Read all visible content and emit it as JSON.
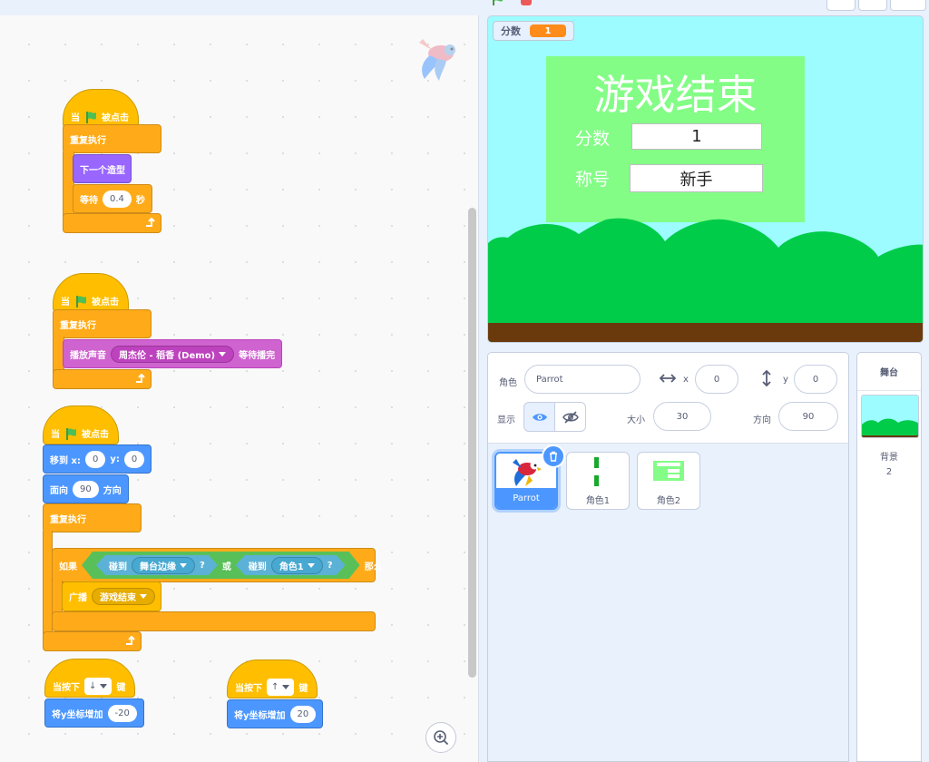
{
  "code": {
    "scripts": [
      {
        "hat": {
          "prefix": "当",
          "suffix": "被点击",
          "icon": "green-flag-icon"
        },
        "forever_label": "重复执行",
        "next_costume": "下一个造型",
        "wait_label": "等待",
        "wait_value": "0.4",
        "wait_unit": "秒"
      },
      {
        "hat": {
          "prefix": "当",
          "suffix": "被点击",
          "icon": "green-flag-icon"
        },
        "forever_label": "重复执行",
        "play_sound_label": "播放声音",
        "sound_name": "周杰伦 - 稻香 (Demo)",
        "play_sound_suffix": "等待播完"
      },
      {
        "hat": {
          "prefix": "当",
          "suffix": "被点击",
          "icon": "green-flag-icon"
        },
        "goto_label": "移到 x:",
        "goto_x": "0",
        "goto_y_label": "y:",
        "goto_y": "0",
        "point_label": "面向",
        "point_value": "90",
        "point_suffix": "方向",
        "forever_label": "重复执行",
        "if_label": "如果",
        "then_label": "那么",
        "touch1_label": "碰到",
        "touch1_target": "舞台边缘",
        "touch1_q": "?",
        "or_label": "或",
        "touch2_label": "碰到",
        "touch2_target": "角色1",
        "touch2_q": "?",
        "broadcast_label": "广播",
        "broadcast_msg": "游戏结束"
      },
      {
        "hat": {
          "prefix": "当按下",
          "key": "↓",
          "suffix": "键"
        },
        "change_label": "将y坐标增加",
        "change_value": "-20"
      },
      {
        "hat": {
          "prefix": "当按下",
          "key": "↑",
          "suffix": "键"
        },
        "change_label": "将y坐标增加",
        "change_value": "20"
      }
    ]
  },
  "stage": {
    "monitor_label": "分数",
    "monitor_value": "1",
    "game_over": {
      "title": "游戏结束",
      "score_label": "分数",
      "score_value": "1",
      "rank_label": "称号",
      "rank_value": "新手"
    }
  },
  "sprite_info": {
    "sprite_label": "角色",
    "sprite_name": "Parrot",
    "x_label": "x",
    "x_value": "0",
    "y_label": "y",
    "y_value": "0",
    "show_label": "显示",
    "size_label": "大小",
    "size_value": "30",
    "direction_label": "方向",
    "direction_value": "90"
  },
  "sprites": [
    {
      "name": "Parrot",
      "selected": true
    },
    {
      "name": "角色1",
      "selected": false
    },
    {
      "name": "角色2",
      "selected": false
    }
  ],
  "stage_pane": {
    "title": "舞台",
    "backdrops_label": "背景",
    "backdrops_count": "2"
  },
  "colors": {
    "events": "#ffbf00",
    "control": "#ffab19",
    "looks": "#9966ff",
    "sound": "#cf63cf",
    "motion": "#4c97ff",
    "sensing": "#5cb1d6",
    "operators": "#59c059",
    "accent": "#4c97ff"
  }
}
